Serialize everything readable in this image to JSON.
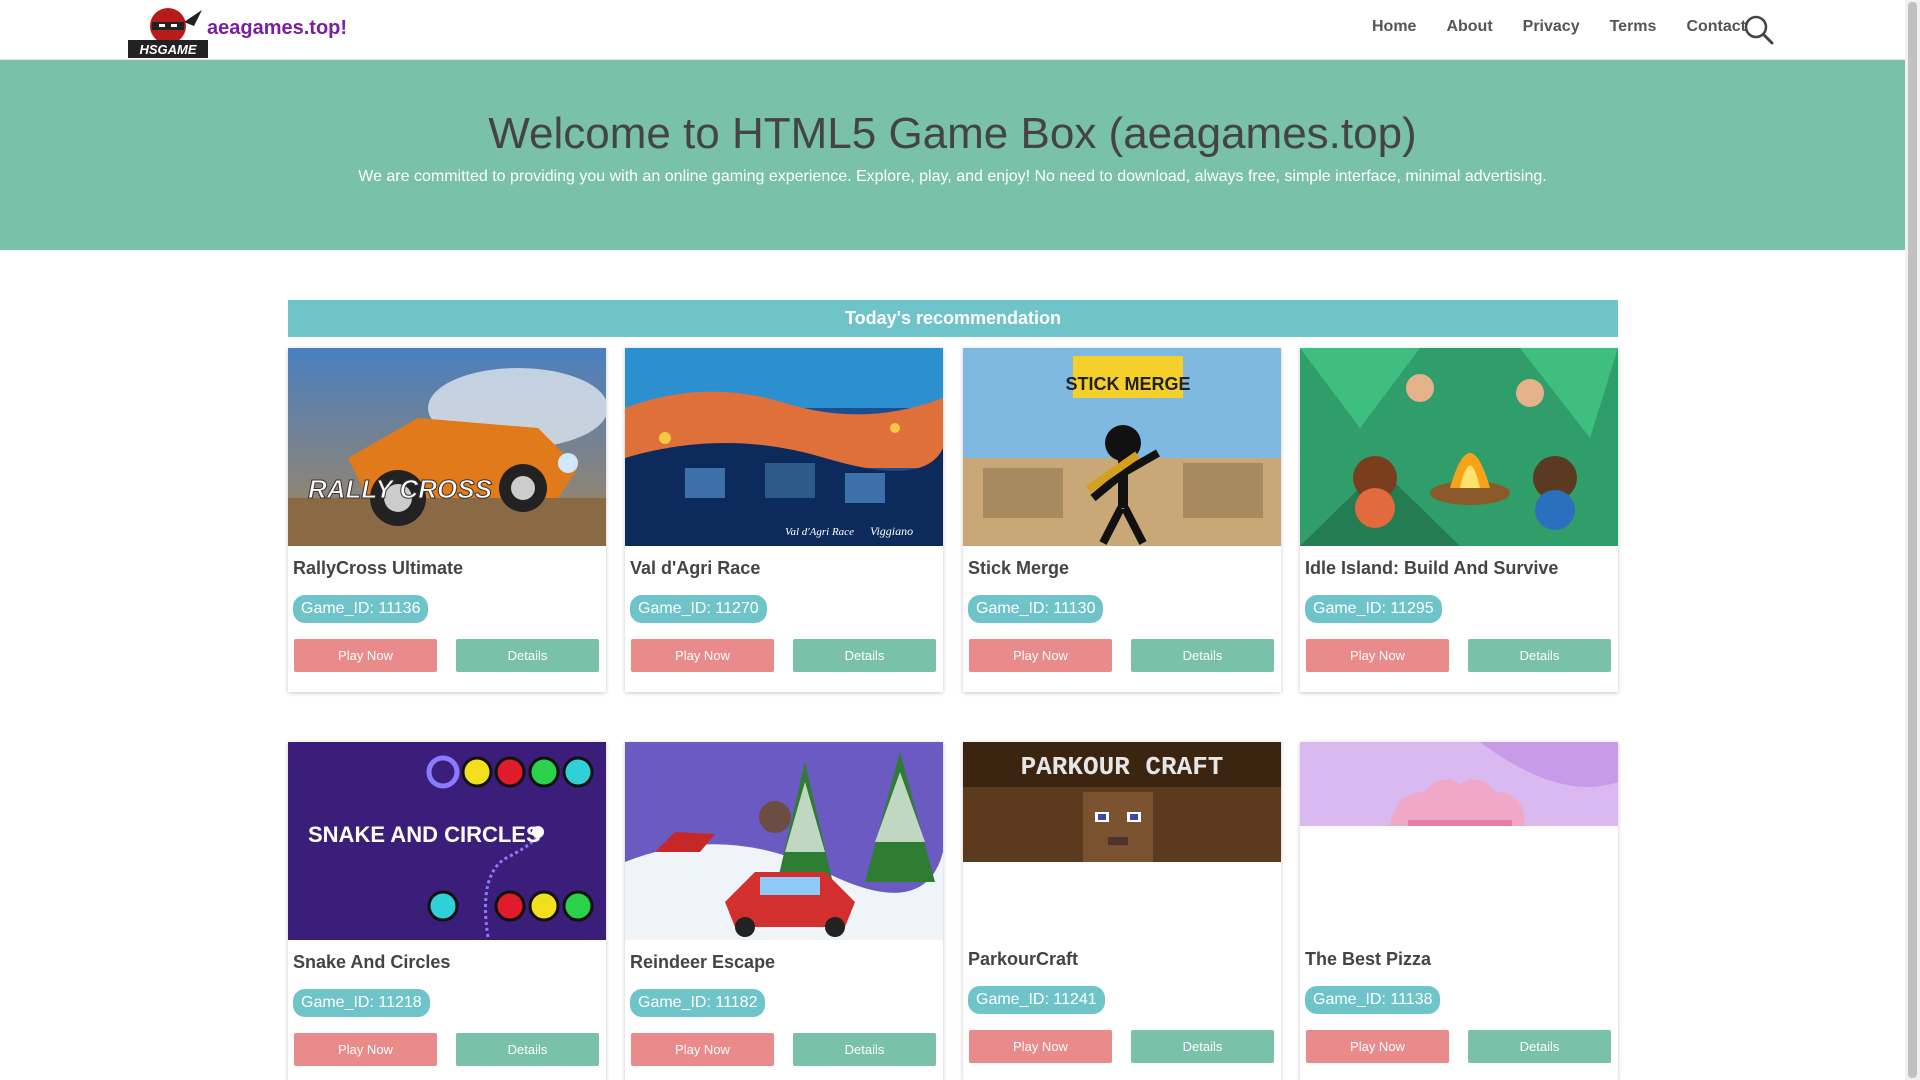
{
  "header": {
    "site_name": "aeagames.top!",
    "logo_text": "HSGAME",
    "nav": [
      "Home",
      "About",
      "Privacy",
      "Terms",
      "Contact"
    ]
  },
  "hero": {
    "title": "Welcome to HTML5 Game Box (aeagames.top)",
    "subtitle": "We are committed to providing you with an online gaming experience. Explore, play, and enjoy! No need to download, always free, simple interface, minimal advertising."
  },
  "section": {
    "title": "Today's recommendation"
  },
  "buttons": {
    "play": "Play Now",
    "details": "Details"
  },
  "games": [
    {
      "title": "RallyCross Ultimate",
      "id": "Game_ID: 11136"
    },
    {
      "title": "Val d'Agri Race",
      "id": "Game_ID: 11270"
    },
    {
      "title": "Stick Merge",
      "id": "Game_ID: 11130"
    },
    {
      "title": "Idle Island: Build And Survive",
      "id": "Game_ID: 11295"
    },
    {
      "title": "Snake And Circles",
      "id": "Game_ID: 11218"
    },
    {
      "title": "Reindeer Escape",
      "id": "Game_ID: 11182"
    },
    {
      "title": "ParkourCraft",
      "id": "Game_ID: 11241"
    },
    {
      "title": "The Best Pizza",
      "id": "Game_ID: 11138"
    }
  ],
  "thumb_text": {
    "rally": "RALLY CROSS",
    "val": "Val d'Agri Race",
    "val2": "Viggiano",
    "stick": "STICK MERGE",
    "snake": "SNAKE AND CIRCLES",
    "parkour": "PARKOUR CRAFT"
  },
  "colors": {
    "hero_bg": "#7ac1a9",
    "section_bar": "#6ec4c8",
    "play_button": "#e98b8b",
    "details_button": "#7ac1a9",
    "site_name": "#7b1fa2"
  }
}
